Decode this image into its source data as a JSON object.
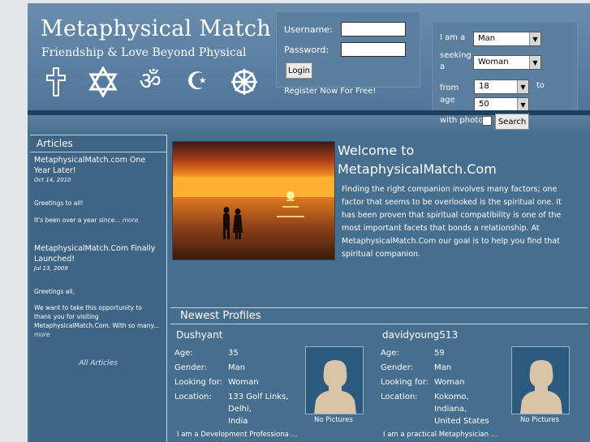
{
  "header": {
    "title": "Metaphysical Match",
    "tagline": "Friendship & Love Beyond Physical",
    "symbols": [
      "cross-icon",
      "star-of-david-icon",
      "om-icon",
      "crescent-star-icon",
      "dharma-wheel-icon"
    ]
  },
  "login": {
    "username_label": "Username:",
    "password_label": "Password:",
    "login_button": "Login",
    "register_link": "Register Now For Free!"
  },
  "search": {
    "i_am_label": "I am a",
    "i_am_value": "Man",
    "seeking_label_1": "seeking",
    "seeking_label_2": "a",
    "seeking_value": "Woman",
    "from_age_label_1": "from",
    "from_age_label_2": "age",
    "age_from": "18",
    "to_label": "to",
    "age_to": "50",
    "with_photo_label": "with photo",
    "search_button": "Search"
  },
  "sidebar": {
    "title": "Articles",
    "articles": [
      {
        "title": "MetaphysicalMatch.com One Year Later!",
        "date": "Oct 14, 2010",
        "greeting": "Greetings to all!",
        "excerpt": "It's been over a year since...",
        "more": "more"
      },
      {
        "title": "MetaphysicalMatch.Com Finally Launched!",
        "date": "Jul 13, 2009",
        "greeting": "Greetings all,",
        "excerpt": "We want to take this opportunity to thank you for visiting MetaphysicalMatch.Com. With so many...",
        "more": "more"
      }
    ],
    "all_articles": "All Articles"
  },
  "main": {
    "welcome_line1": "Welcome to",
    "welcome_line2": "MetaphysicalMatch.Com",
    "intro": "Finding the right companion involves many factors; one factor that seems to be overlooked is the spiritual one. It has been proven that spiritual compatibility is one of the most important facets that bonds a relationship. At MetaphysicalMatch.Com our goal is to help you find that spiritual companion."
  },
  "profiles": {
    "title": "Newest Profiles",
    "labels": {
      "age": "Age:",
      "gender": "Gender:",
      "looking": "Looking for:",
      "location": "Location:"
    },
    "no_pictures": "No Pictures",
    "items": [
      {
        "name": "Dushyant",
        "age": "35",
        "gender": "Man",
        "looking_for": "Woman",
        "location_1": "133 Golf Links,",
        "location_2": "Delhi,",
        "location_3": "India",
        "desc": "I am a Development Professiona ..."
      },
      {
        "name": "davidyoung513",
        "age": "59",
        "gender": "Man",
        "looking_for": "Woman",
        "location_1": "Kokomo,",
        "location_2": "Indiana,",
        "location_3": "United States",
        "desc": "I am a practical Metaphysician ..."
      }
    ]
  },
  "colors": {
    "page_bg": "#466e8e",
    "header_bg": "#5a7fa2",
    "outer_bg": "#e4e6e8"
  }
}
